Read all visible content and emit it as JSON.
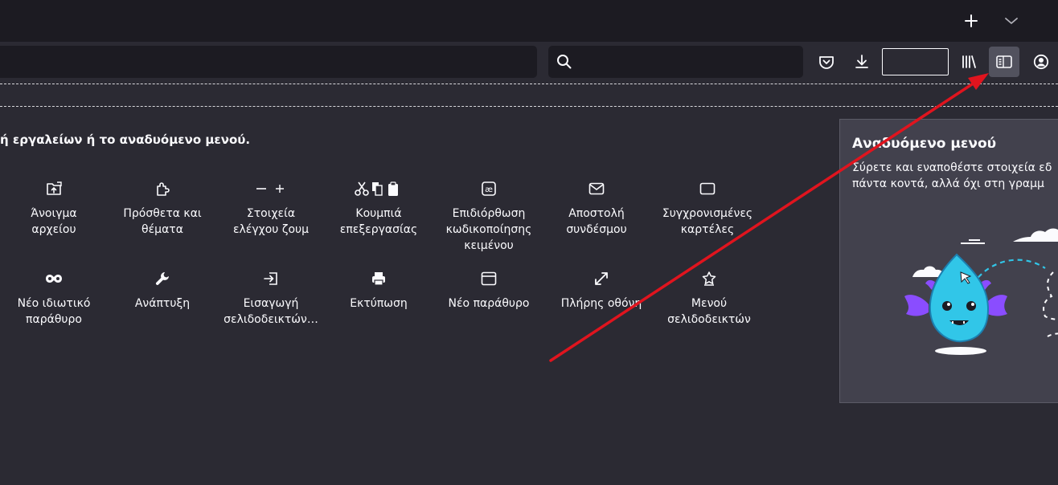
{
  "customize": {
    "instruction": "ή εργαλείων ή το αναδυόμενο μενού.",
    "items": [
      {
        "label": "Άνοιγμα\nαρχείου",
        "icon": "open-file-icon"
      },
      {
        "label": "Πρόσθετα και\nθέματα",
        "icon": "addons-icon"
      },
      {
        "label": "Στοιχεία\nελέγχου ζουμ",
        "icon": "zoom-controls-icon"
      },
      {
        "label": "Κουμπιά\nεπεξεργασίας",
        "icon": "edit-controls-icon"
      },
      {
        "label": "Επιδιόρθωση\nκωδικοποίησης\nκειμένου",
        "icon": "text-encoding-icon"
      },
      {
        "label": "Αποστολή\nσυνδέσμου",
        "icon": "email-link-icon"
      },
      {
        "label": "Συγχρονισμένες\nκαρτέλες",
        "icon": "synced-tabs-icon"
      },
      {
        "label": "Νέο ιδιωτικό\nπαράθυρο",
        "icon": "private-window-icon"
      },
      {
        "label": "Ανάπτυξη",
        "icon": "wrench-icon"
      },
      {
        "label": "Εισαγωγή\nσελιδοδεικτών…",
        "icon": "import-icon"
      },
      {
        "label": "Εκτύπωση",
        "icon": "print-icon"
      },
      {
        "label": "Νέο παράθυρο",
        "icon": "new-window-icon"
      },
      {
        "label": "Πλήρης οθόνη",
        "icon": "fullscreen-icon"
      },
      {
        "label": "Μενού\nσελιδοδεικτών",
        "icon": "bookmarks-menu-icon"
      }
    ]
  },
  "overflow_panel": {
    "title": "Αναδυόμενο μενού",
    "description": "Σύρετε και εναποθέστε στοιχεία εδ\nπάντα κοντά, αλλά όχι στη γραμμ"
  },
  "tabbar": {
    "new_tab_icon": "plus-icon",
    "list_tabs_icon": "chevron-down-icon"
  },
  "toolbar": {
    "icons": [
      "search-icon",
      "pocket-icon",
      "download-icon",
      "library-icon",
      "sidebar-icon",
      "account-icon"
    ]
  },
  "colors": {
    "background": "#2b2a33",
    "tabbar": "#1c1b22",
    "panel": "#42414d",
    "annotation_arrow": "#e0141e"
  }
}
